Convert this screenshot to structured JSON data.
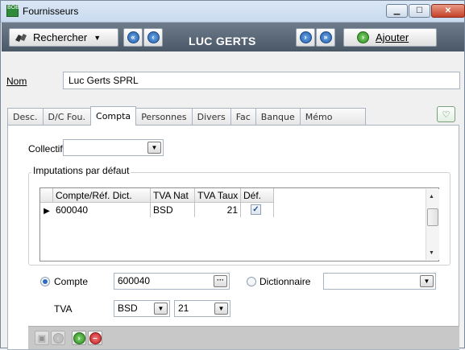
{
  "window": {
    "title": "Fournisseurs",
    "app_icon_text": "BOB"
  },
  "toolbar": {
    "search_label": "Rechercher",
    "record_name": "LUC GERTS",
    "add_label": "Ajouter"
  },
  "name": {
    "label": "Nom",
    "value": "Luc Gerts SPRL"
  },
  "tabs": [
    {
      "label": "Desc."
    },
    {
      "label": "D/C Fou."
    },
    {
      "label": "Compta"
    },
    {
      "label": "Personnes"
    },
    {
      "label": "Divers"
    },
    {
      "label": "Fac"
    },
    {
      "label": "Banque"
    },
    {
      "label": "Mémo"
    }
  ],
  "active_tab": "Compta",
  "compta": {
    "collectif_label": "Collectif",
    "collectif_value": "",
    "imputations_title": "Imputations par défaut",
    "grid": {
      "columns": [
        "Compte/Réf. Dict.",
        "TVA Nat",
        "TVA Taux",
        "Déf."
      ],
      "rows": [
        {
          "compte": "600040",
          "tva_nat": "BSD",
          "tva_taux": "21",
          "def": true
        }
      ]
    },
    "compte_radio_label": "Compte",
    "compte_value": "600040",
    "dictionnaire_radio_label": "Dictionnaire",
    "dictionnaire_value": "",
    "tva_label": "TVA",
    "tva_nat_value": "BSD",
    "tva_taux_value": "21"
  },
  "colors": {
    "toolbar_bg": "#5c6977",
    "accent_blue": "#2e6bc5",
    "green": "#2c8a20",
    "red": "#c21d1d"
  }
}
